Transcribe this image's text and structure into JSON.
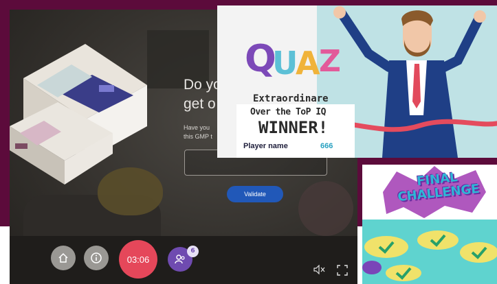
{
  "escape_room": {
    "question_line1": "Do yo",
    "question_line2": "get o",
    "subtext_line1": "Have you",
    "subtext_line2": "this GMP t",
    "answer_placeholder": "",
    "validate_label": "Validate",
    "timer": "03:06",
    "team_count": "6",
    "icons": {
      "home": "home-icon",
      "info": "info-icon",
      "team": "team-icon",
      "sound": "mute-icon",
      "fullscreen": "fullscreen-icon"
    }
  },
  "quiz_card": {
    "logo": "QUAZ",
    "line1": "Extraordinare",
    "line2": "Over the ToP IQ",
    "line3": "WINNER!",
    "player_label": "Player name",
    "player_score": "666"
  },
  "final_challenge": {
    "title": "FINAL CHALLENGE"
  },
  "colors": {
    "maroon": "#5c0b3b",
    "timer_red": "#e5475a",
    "validate_blue": "#2158b8",
    "team_purple": "#6f4bb0",
    "score_teal": "#27a0c0"
  }
}
